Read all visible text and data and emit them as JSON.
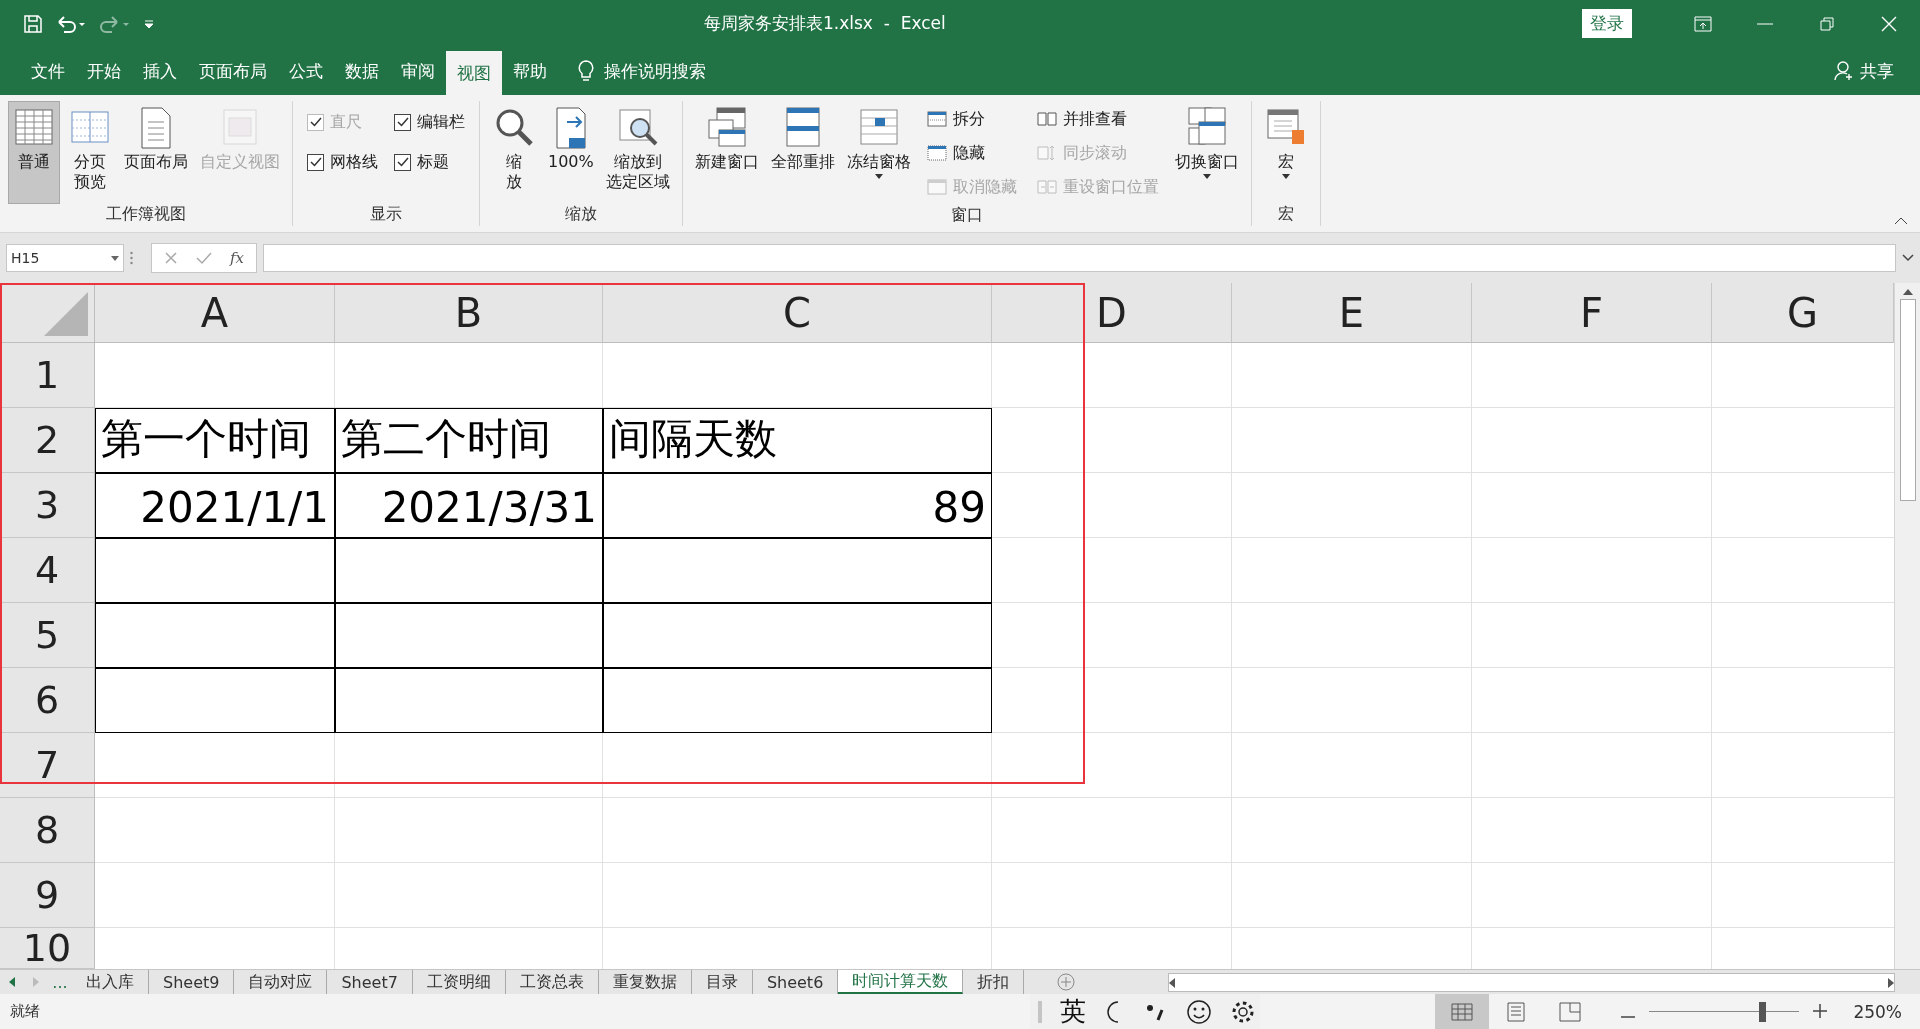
{
  "title_bar": {
    "title": "每周家务安排表1.xlsx  -  Excel",
    "login": "登录"
  },
  "menu_tabs": [
    {
      "label": "文件",
      "selected": false
    },
    {
      "label": "开始",
      "selected": false
    },
    {
      "label": "插入",
      "selected": false
    },
    {
      "label": "页面布局",
      "selected": false
    },
    {
      "label": "公式",
      "selected": false
    },
    {
      "label": "数据",
      "selected": false
    },
    {
      "label": "审阅",
      "selected": false
    },
    {
      "label": "视图",
      "selected": true
    },
    {
      "label": "帮助",
      "selected": false
    }
  ],
  "tell_me": "操作说明搜索",
  "share": "共享",
  "ribbon": {
    "groups": [
      {
        "title": "工作簿视图",
        "columns": [
          {
            "kind": "large",
            "label": [
              "普通"
            ],
            "selected": true,
            "disabled": false,
            "dropdown": false
          },
          {
            "kind": "large",
            "label": [
              "分页",
              "预览"
            ],
            "selected": false,
            "disabled": false,
            "dropdown": false
          },
          {
            "kind": "large",
            "label": [
              "页面布局"
            ],
            "selected": false,
            "disabled": false,
            "dropdown": false
          },
          {
            "kind": "large",
            "label": [
              "自定义视图"
            ],
            "selected": false,
            "disabled": true,
            "dropdown": false
          }
        ]
      },
      {
        "title": "显示",
        "columns": [
          {
            "kind": "stack",
            "items": [
              {
                "kind": "check",
                "label": "直尺",
                "checked": true,
                "disabled": true
              },
              {
                "kind": "check",
                "label": "网格线",
                "checked": true,
                "disabled": false
              }
            ]
          },
          {
            "kind": "stack",
            "items": [
              {
                "kind": "check",
                "label": "编辑栏",
                "checked": true,
                "disabled": false
              },
              {
                "kind": "check",
                "label": "标题",
                "checked": true,
                "disabled": false
              }
            ]
          }
        ]
      },
      {
        "title": "缩放",
        "columns": [
          {
            "kind": "large",
            "label": [
              "缩",
              "放"
            ],
            "selected": false,
            "disabled": false,
            "dropdown": false
          },
          {
            "kind": "large",
            "label": [
              "100%"
            ],
            "selected": false,
            "disabled": false,
            "dropdown": false
          },
          {
            "kind": "large",
            "label": [
              "缩放到",
              "选定区域"
            ],
            "selected": false,
            "disabled": false,
            "dropdown": false
          }
        ]
      },
      {
        "title": "窗口",
        "columns": [
          {
            "kind": "large",
            "label": [
              "新建窗口"
            ],
            "selected": false,
            "disabled": false,
            "dropdown": false
          },
          {
            "kind": "large",
            "label": [
              "全部重排"
            ],
            "selected": false,
            "disabled": false,
            "dropdown": false
          },
          {
            "kind": "large",
            "label": [
              "冻结窗格"
            ],
            "selected": false,
            "disabled": false,
            "dropdown": true
          },
          {
            "kind": "stack",
            "items": [
              {
                "kind": "small",
                "label": "拆分",
                "disabled": false
              },
              {
                "kind": "small",
                "label": "隐藏",
                "disabled": false
              },
              {
                "kind": "small",
                "label": "取消隐藏",
                "disabled": true
              }
            ]
          },
          {
            "kind": "stack",
            "items": [
              {
                "kind": "small",
                "label": "并排查看",
                "disabled": false
              },
              {
                "kind": "small",
                "label": "同步滚动",
                "disabled": true
              },
              {
                "kind": "small",
                "label": "重设窗口位置",
                "disabled": true
              }
            ]
          },
          {
            "kind": "large",
            "label": [
              "切换窗口"
            ],
            "selected": false,
            "disabled": false,
            "dropdown": true
          }
        ]
      },
      {
        "title": "宏",
        "columns": [
          {
            "kind": "large",
            "label": [
              "宏"
            ],
            "selected": false,
            "disabled": false,
            "dropdown": true
          }
        ]
      }
    ]
  },
  "formula_bar": {
    "name_box": "H15",
    "function_label": "fx"
  },
  "sheet": {
    "columns": [
      "A",
      "B",
      "C",
      "D",
      "E",
      "F",
      "G"
    ],
    "rows": [
      {
        "header": "1"
      },
      {
        "header": "2",
        "cells": [
          {
            "bordered": true,
            "kind": "text",
            "text": "第一个时间"
          },
          {
            "bordered": true,
            "kind": "text",
            "text": "第二个时间"
          },
          {
            "bordered": true,
            "kind": "text",
            "text": "间隔天数"
          }
        ]
      },
      {
        "header": "3",
        "cells": [
          {
            "bordered": true,
            "kind": "number",
            "text": "2021/1/1"
          },
          {
            "bordered": true,
            "kind": "number",
            "text": "2021/3/31"
          },
          {
            "bordered": true,
            "kind": "number",
            "text": "89"
          }
        ]
      },
      {
        "header": "4",
        "cells": [
          {
            "bordered": true
          },
          {
            "bordered": true
          },
          {
            "bordered": true
          }
        ]
      },
      {
        "header": "5",
        "cells": [
          {
            "bordered": true
          },
          {
            "bordered": true
          },
          {
            "bordered": true
          }
        ]
      },
      {
        "header": "6",
        "cells": [
          {
            "bordered": true
          },
          {
            "bordered": true
          },
          {
            "bordered": true
          }
        ]
      },
      {
        "header": "7"
      },
      {
        "header": "8"
      },
      {
        "header": "9"
      },
      {
        "header": "10"
      }
    ]
  },
  "sheet_tabs": {
    "more": "...",
    "tabs": [
      {
        "label": "出入库",
        "selected": false
      },
      {
        "label": "Sheet9",
        "selected": false
      },
      {
        "label": "自动对应",
        "selected": false
      },
      {
        "label": "Sheet7",
        "selected": false
      },
      {
        "label": "工资明细",
        "selected": false
      },
      {
        "label": "工资总表",
        "selected": false
      },
      {
        "label": "重复数据",
        "selected": false
      },
      {
        "label": "目录",
        "selected": false
      },
      {
        "label": "Sheet6",
        "selected": false
      },
      {
        "label": "时间计算天数",
        "selected": true
      },
      {
        "label": "折扣",
        "selected": false
      }
    ]
  },
  "ime_bar": {
    "language": "英"
  },
  "status_bar": {
    "status": "就绪",
    "views": [
      {
        "selected": true
      },
      {
        "selected": false
      },
      {
        "selected": false
      }
    ],
    "zoom": {
      "level": 0.75,
      "reading": "250%"
    }
  }
}
